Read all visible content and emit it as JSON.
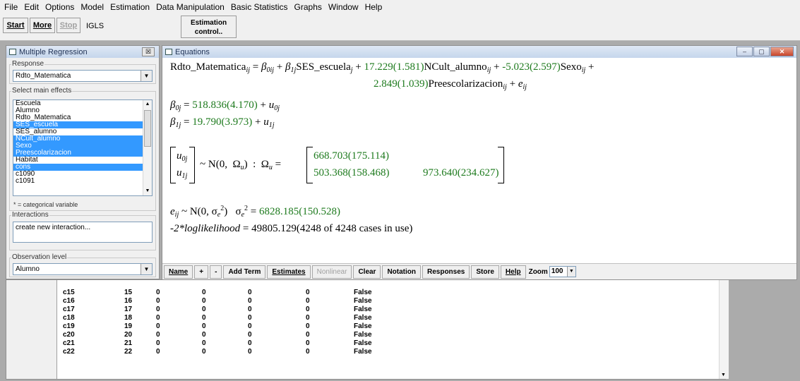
{
  "menubar": [
    "File",
    "Edit",
    "Options",
    "Model",
    "Estimation",
    "Data Manipulation",
    "Basic Statistics",
    "Graphs",
    "Window",
    "Help"
  ],
  "toolbar": {
    "start": "Start",
    "more": "More",
    "stop": "Stop",
    "method": "IGLS",
    "estimation_line1": "Estimation",
    "estimation_line2": "control.."
  },
  "mr_panel": {
    "title": "Multiple Regression",
    "close": "☒",
    "response_label": "Response",
    "response_value": "Rdto_Matematica",
    "main_effects_label": "Select main effects",
    "variables": [
      {
        "name": "Escuela",
        "selected": false
      },
      {
        "name": "Alumno",
        "selected": false
      },
      {
        "name": "Rdto_Matematica",
        "selected": false
      },
      {
        "name": "SES_escuela",
        "selected": true
      },
      {
        "name": "SES_alumno",
        "selected": false
      },
      {
        "name": "NCult_alumno",
        "selected": true
      },
      {
        "name": "Sexo",
        "selected": true
      },
      {
        "name": "Preescolarizacion",
        "selected": true
      },
      {
        "name": "Habitat",
        "selected": false
      },
      {
        "name": "cons",
        "selected": true
      },
      {
        "name": "c1090",
        "selected": false
      },
      {
        "name": "c1091",
        "selected": false
      }
    ],
    "categorical_note": "* = categorical variable",
    "interactions_label": "Interactions",
    "interactions_text": "create new interaction...",
    "obs_level_label": "Observation level",
    "obs_level_value": "Alumno"
  },
  "equations": {
    "title": "Equations",
    "l1_a": "Rdto_Matematica",
    "l1_b": "SES_escuela",
    "l1_c": "17.229(1.581)",
    "l1_d": "NCult_alumno",
    "l1_e": "-5.023(2.597)",
    "l1_f": "Sexo",
    "l2_a": "2.849(1.039)",
    "l2_b": "Preescolarizacion",
    "b0_val": "518.836(4.170)",
    "b1_val": "19.790(3.973)",
    "omega_11": "668.703(175.114)",
    "omega_21": "503.368(158.468)",
    "omega_22": "973.640(234.627)",
    "sigma_e": "6828.185(150.528)",
    "loglik_label": "-2*loglikelihood",
    "loglik_value": "49805.129(4248 of 4248 cases in use)"
  },
  "eq_toolbar": {
    "name": "Name",
    "plus": "+",
    "minus": "-",
    "add_term": "Add Term",
    "estimates": "Estimates",
    "nonlinear": "Nonlinear",
    "clear": "Clear",
    "notation": "Notation",
    "responses": "Responses",
    "store": "Store",
    "help": "Help",
    "zoom_label": "Zoom",
    "zoom_value": "100"
  },
  "data_rows": [
    {
      "name": "c15",
      "n": "15",
      "a": "0",
      "b": "0",
      "c": "0",
      "d": "0",
      "f": "False"
    },
    {
      "name": "c16",
      "n": "16",
      "a": "0",
      "b": "0",
      "c": "0",
      "d": "0",
      "f": "False"
    },
    {
      "name": "c17",
      "n": "17",
      "a": "0",
      "b": "0",
      "c": "0",
      "d": "0",
      "f": "False"
    },
    {
      "name": "c18",
      "n": "18",
      "a": "0",
      "b": "0",
      "c": "0",
      "d": "0",
      "f": "False"
    },
    {
      "name": "c19",
      "n": "19",
      "a": "0",
      "b": "0",
      "c": "0",
      "d": "0",
      "f": "False"
    },
    {
      "name": "c20",
      "n": "20",
      "a": "0",
      "b": "0",
      "c": "0",
      "d": "0",
      "f": "False"
    },
    {
      "name": "c21",
      "n": "21",
      "a": "0",
      "b": "0",
      "c": "0",
      "d": "0",
      "f": "False"
    },
    {
      "name": "c22",
      "n": "22",
      "a": "0",
      "b": "0",
      "c": "0",
      "d": "0",
      "f": "False"
    }
  ]
}
